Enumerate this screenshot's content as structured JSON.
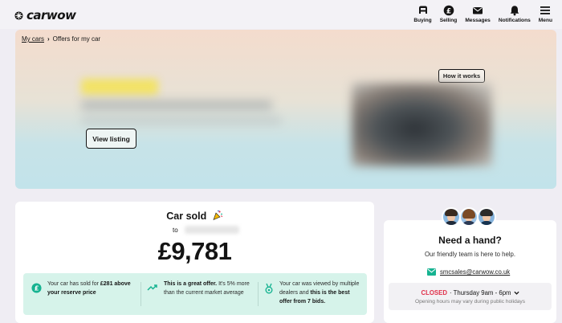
{
  "header": {
    "brand": "carwow",
    "nav": [
      {
        "label": "Buying",
        "icon": "steering-wheel-icon"
      },
      {
        "label": "Selling",
        "icon": "pound-coin-icon"
      },
      {
        "label": "Messages",
        "icon": "envelope-icon"
      },
      {
        "label": "Notifications",
        "icon": "bell-icon"
      },
      {
        "label": "Menu",
        "icon": "hamburger-icon"
      }
    ]
  },
  "breadcrumb": {
    "parent": "My cars",
    "current": "Offers for my car"
  },
  "hero": {
    "view_listing_label": "View listing",
    "how_it_works_label": "How it works"
  },
  "sold": {
    "title": "Car sold",
    "to_label": "to",
    "price": "£9,781",
    "info": [
      {
        "icon": "pound-circle-icon",
        "pre": "Your car has sold for ",
        "bold": "£281 above your reserve price",
        "post": ""
      },
      {
        "icon": "trending-up-icon",
        "pre": "",
        "bold": "This is a great offer.",
        "post": " It's 5% more than the current market average"
      },
      {
        "icon": "award-medal-icon",
        "pre": "Your car was viewed by multiple dealers and ",
        "bold": "this is the best offer from 7 bids.",
        "post": ""
      }
    ]
  },
  "help": {
    "title": "Need a hand?",
    "subtitle": "Our friendly team is here to help.",
    "email": "smcsales@carwow.co.uk",
    "status": "CLOSED",
    "hours": "· Thursday 9am - 6pm",
    "note": "Opening hours may vary during public holidays"
  },
  "colors": {
    "accent_mint": "#d6f3ea",
    "status_closed": "#e0304a",
    "email_icon": "#16b391",
    "page_bg": "#efedf3"
  }
}
